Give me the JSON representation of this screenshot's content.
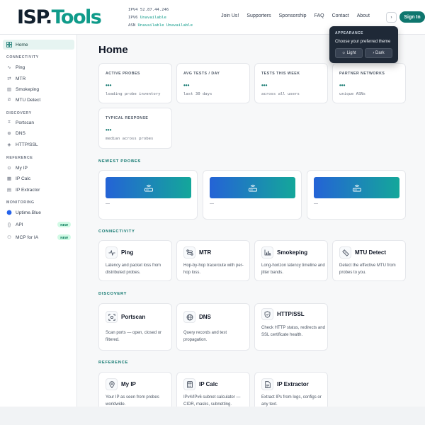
{
  "header": {
    "logo_part1": "ISP.",
    "logo_part2": "Tools",
    "ipv4_label": "IPV4",
    "ipv4_value": "52.87.44.246",
    "ipv6_label": "IPV6",
    "ipv6_value": "Unavailable",
    "asn_label": "ASN",
    "asn_value": "Unavailable Unavailable",
    "nav": [
      "Join Us!",
      "Supporters",
      "Sponsorship",
      "FAQ",
      "Contact",
      "About"
    ],
    "theme_toggle_glyph": "›",
    "signin_label": "Sign In"
  },
  "appearance_popover": {
    "title": "APPEARANCE",
    "message": "Choose your preferred theme",
    "light_label": "☼ Light",
    "dark_label": "› Dark"
  },
  "sidebar": {
    "home": "Home",
    "sections": [
      {
        "title": "CONNECTIVITY",
        "items": [
          {
            "label": "Ping",
            "icon": "pulse-icon"
          },
          {
            "label": "MTR",
            "icon": "route-icon"
          },
          {
            "label": "Smokeping",
            "icon": "chart-icon"
          },
          {
            "label": "MTU Detect",
            "icon": "ruler-icon"
          }
        ]
      },
      {
        "title": "DISCOVERY",
        "items": [
          {
            "label": "Portscan",
            "icon": "scan-icon"
          },
          {
            "label": "DNS",
            "icon": "globe-icon"
          },
          {
            "label": "HTTP/SSL",
            "icon": "shield-icon"
          }
        ]
      },
      {
        "title": "REFERENCE",
        "items": [
          {
            "label": "My IP",
            "icon": "pin-icon"
          },
          {
            "label": "IP Calc",
            "icon": "calculator-icon"
          },
          {
            "label": "IP Extractor",
            "icon": "document-icon"
          }
        ]
      },
      {
        "title": "MONITORING",
        "items": [
          {
            "label": "Uptime.Blue",
            "icon": "uptime-icon"
          },
          {
            "label": "API",
            "icon": "braces-icon",
            "badge": "NEW"
          },
          {
            "label": "MCP for IA",
            "icon": "mcp-icon",
            "badge": "NEW"
          }
        ]
      }
    ]
  },
  "main": {
    "title": "Home",
    "stats": [
      {
        "label": "ACTIVE PROBES",
        "value": "•••",
        "sub": "loading probe inventory"
      },
      {
        "label": "AVG TESTS / DAY",
        "value": "•••",
        "sub": "last 30 days"
      },
      {
        "label": "TESTS THIS WEEK",
        "value": "•••",
        "sub": "across all users"
      },
      {
        "label": "PARTNER NETWORKS",
        "value": "•••",
        "sub": "unique ASNs"
      },
      {
        "label": "TYPICAL RESPONSE",
        "value": "•••",
        "sub": "median across probes"
      }
    ],
    "newest_probes_title": "NEWEST PROBES",
    "probes": [
      {
        "text": "—"
      },
      {
        "text": "—"
      },
      {
        "text": "—"
      }
    ],
    "connectivity_title": "CONNECTIVITY",
    "connectivity": [
      {
        "name": "Ping",
        "desc": "Latency and packet loss from distributed probes."
      },
      {
        "name": "MTR",
        "desc": "Hop-by-hop traceroute with per-hop loss."
      },
      {
        "name": "Smokeping",
        "desc": "Long-horizon latency timeline and jitter bands."
      },
      {
        "name": "MTU Detect",
        "desc": "Detect the effective MTU from probes to you."
      }
    ],
    "discovery_title": "DISCOVERY",
    "discovery": [
      {
        "name": "Portscan",
        "desc": "Scan ports — open, closed or filtered."
      },
      {
        "name": "DNS",
        "desc": "Query records and test propagation."
      },
      {
        "name": "HTTP/SSL",
        "desc": "Check HTTP status, redirects and SSL certificate health."
      }
    ],
    "reference_title": "REFERENCE",
    "reference": [
      {
        "name": "My IP",
        "desc": "Your IP as seen from probes worldwide."
      },
      {
        "name": "IP Calc",
        "desc": "IPv4/IPv6 subnet calculator — CIDR, masks, subnetting."
      },
      {
        "name": "IP Extractor",
        "desc": "Extract IPs from logs, configs or any text."
      }
    ]
  },
  "colors": {
    "accent": "#0f766e",
    "brand": "#0f9b8a",
    "popover_bg": "#1f2937"
  }
}
